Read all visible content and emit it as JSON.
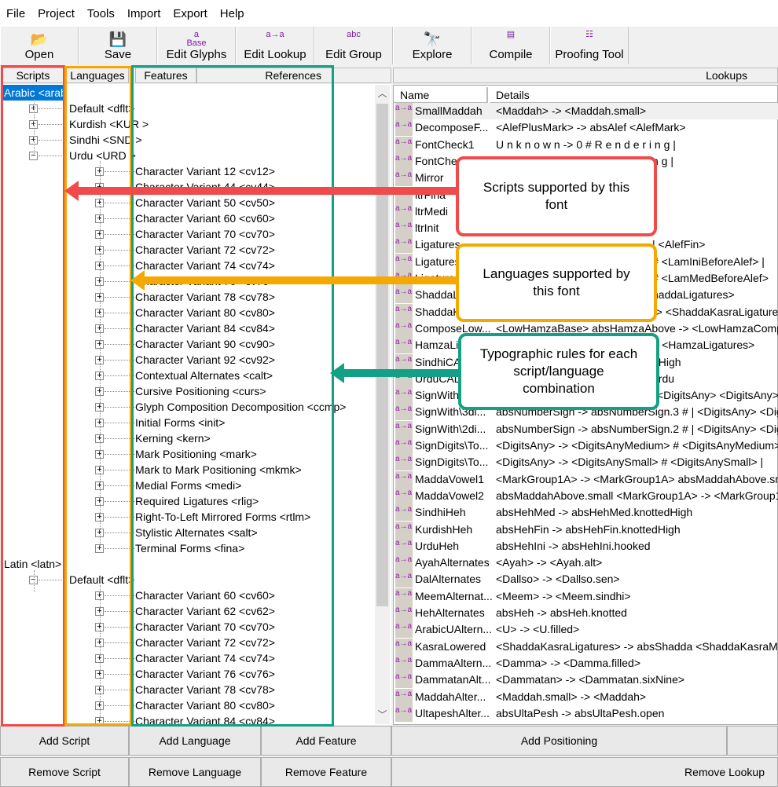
{
  "menu": [
    "File",
    "Project",
    "Tools",
    "Import",
    "Export",
    "Help"
  ],
  "toolbar": [
    {
      "label": "Open",
      "icon": "folder-open-icon",
      "glyph": "📂"
    },
    {
      "label": "Save",
      "icon": "floppy-disk-icon",
      "glyph": "💾"
    },
    {
      "label": "Edit Glyphs",
      "icon": "glyph-base-icon",
      "glyph": "a\nBase"
    },
    {
      "label": "Edit Lookup",
      "icon": "lookup-icon",
      "glyph": "a→a"
    },
    {
      "label": "Edit Group",
      "icon": "group-abc-icon",
      "glyph": "abc"
    },
    {
      "label": "Explore",
      "icon": "binoculars-icon",
      "glyph": "🔭"
    },
    {
      "label": "Compile",
      "icon": "compile-stack-icon",
      "glyph": "▤"
    },
    {
      "label": "Proofing Tool",
      "icon": "proofing-icon",
      "glyph": "☷"
    }
  ],
  "headers": {
    "scripts": "Scripts",
    "languages": "Languages",
    "features": "Features",
    "references": "References",
    "lookups": "Lookups",
    "name": "Name",
    "details": "Details"
  },
  "tree": {
    "scripts": [
      {
        "label": "Arabic <arab",
        "selected": true,
        "languages": [
          {
            "label": "Default <dflt>",
            "expanded": false,
            "features": []
          },
          {
            "label": "Kurdish <KUR >",
            "expanded": false,
            "features": []
          },
          {
            "label": "Sindhi <SND >",
            "expanded": false,
            "features": []
          },
          {
            "label": "Urdu <URD >",
            "expanded": true,
            "features": [
              "Character Variant 12 <cv12>",
              "Character Variant 44 <cv44>",
              "Character Variant 50 <cv50>",
              "Character Variant 60 <cv60>",
              "Character Variant 70 <cv70>",
              "Character Variant 72 <cv72>",
              "Character Variant 74 <cv74>",
              "Character Variant 76 <cv76>",
              "Character Variant 78 <cv78>",
              "Character Variant 80 <cv80>",
              "Character Variant 84 <cv84>",
              "Character Variant 90 <cv90>",
              "Character Variant 92 <cv92>",
              "Contextual Alternates <calt>",
              "Cursive Positioning <curs>",
              "Glyph Composition Decomposition <ccmp>",
              "Initial Forms <init>",
              "Kerning <kern>",
              "Mark Positioning <mark>",
              "Mark to Mark Positioning <mkmk>",
              "Medial Forms <medi>",
              "Required Ligatures <rlig>",
              "Right-To-Left Mirrored Forms <rtlm>",
              "Stylistic Alternates <salt>",
              "Terminal Forms <fina>"
            ]
          }
        ]
      },
      {
        "label": "Latin <latn>",
        "selected": false,
        "languages": [
          {
            "label": "Default <dflt>",
            "expanded": true,
            "features": [
              "Character Variant 60 <cv60>",
              "Character Variant 62 <cv62>",
              "Character Variant 70 <cv70>",
              "Character Variant 72 <cv72>",
              "Character Variant 74 <cv74>",
              "Character Variant 76 <cv76>",
              "Character Variant 78 <cv78>",
              "Character Variant 80 <cv80>",
              "Character Variant 84 <cv84>"
            ]
          }
        ]
      }
    ]
  },
  "lookup_icon": "a→a",
  "lookups": [
    [
      "SmallMaddah",
      "<Maddah> -> <Maddah.small>"
    ],
    [
      "DecomposeF...",
      "<AlefPlusMark> -> absAlef <AlefMark>"
    ],
    [
      "FontCheck1",
      "U n k n o w n -> 0  # R e n d e r i n g |"
    ],
    [
      "FontChe",
      "n g |"
    ],
    [
      "Mirror",
      ""
    ],
    [
      "ltrFina",
      ""
    ],
    [
      "ltrMedi",
      ""
    ],
    [
      "ltrInit",
      ""
    ],
    [
      "Ligatures",
      "| <AlefFin>"
    ],
    [
      "Ligatures",
      "# <LamIniBeforeAlef> |"
    ],
    [
      "Ligatures",
      "# <LamMedBeforeAlef>"
    ],
    [
      "ShaddaL",
      "haddaLigatures>"
    ],
    [
      "ShaddaK",
      "-> <ShaddaKasraLigatures"
    ],
    [
      "ComposeLow...",
      "<LowHamzaBase> absHamzaAbove -> <LowHamzaCompose"
    ],
    [
      "HamzaLi",
      "> <HamzaLigatures>"
    ],
    [
      "SindhiCA",
      "dHigh"
    ],
    [
      "UrduCAL",
      "urdu"
    ],
    [
      "SignWith",
      "<DigitsAny> <DigitsAny> <"
    ],
    [
      "SignWith\\3di...",
      "absNumberSign -> absNumberSign.3  # | <DigitsAny> <Digits"
    ],
    [
      "SignWith\\2di...",
      "absNumberSign -> absNumberSign.2  # | <DigitsAny> <Digits"
    ],
    [
      "SignDigits\\To...",
      "<DigitsAny> -> <DigitsAnyMedium>  # <DigitsAnyMedium> |"
    ],
    [
      "SignDigits\\To...",
      "<DigitsAny> -> <DigitsAnySmall>  # <DigitsAnySmall> |"
    ],
    [
      "MaddaVowel1",
      "<MarkGroup1A> -> <MarkGroup1A> absMaddahAbove.small"
    ],
    [
      "MaddaVowel2",
      "absMaddahAbove.small <MarkGroup1A> -> <MarkGroup1A>"
    ],
    [
      "SindhiHeh",
      "absHehMed -> absHehMed.knottedHigh"
    ],
    [
      "KurdishHeh",
      "absHehFin -> absHehFin.knottedHigh"
    ],
    [
      "UrduHeh",
      "absHehIni -> absHehIni.hooked"
    ],
    [
      "AyahAlternates",
      "<Ayah> -> <Ayah.alt>"
    ],
    [
      "DalAlternates",
      "<Dallso> -> <Dallso.sen>"
    ],
    [
      "MeemAlternat...",
      "<Meem> -> <Meem.sindhi>"
    ],
    [
      "HehAlternates",
      "absHeh -> absHeh.knotted"
    ],
    [
      "ArabicUAltern...",
      "<U> -> <U.filled>"
    ],
    [
      "KasraLowered",
      "<ShaddaKasraLigatures> -> absShadda <ShaddaKasraMarks"
    ],
    [
      "DammaAltern...",
      "<Damma> -> <Damma.filled>"
    ],
    [
      "DammatanAlt...",
      "<Dammatan> -> <Dammatan.sixNine>"
    ],
    [
      "MaddahAlter...",
      "<Maddah.small> -> <Maddah>"
    ],
    [
      "UltapeshAlter...",
      "absUltaPesh -> absUltaPesh.open"
    ]
  ],
  "buttons": {
    "add_script": "Add Script",
    "add_language": "Add Language",
    "add_feature": "Add Feature",
    "add_positioning": "Add Positioning",
    "remove_script": "Remove Script",
    "remove_language": "Remove Language",
    "remove_feature": "Remove Feature",
    "remove_lookup": "Remove Lookup"
  },
  "annotations": {
    "scripts": {
      "text": "Scripts supported by this font",
      "color": "#f04a4a"
    },
    "languages": {
      "text": "Languages supported by this font",
      "color": "#f5a800"
    },
    "features": {
      "text": "Typographic rules for each script/language combination",
      "color": "#14a085"
    }
  },
  "selection_color": "#0078d7"
}
